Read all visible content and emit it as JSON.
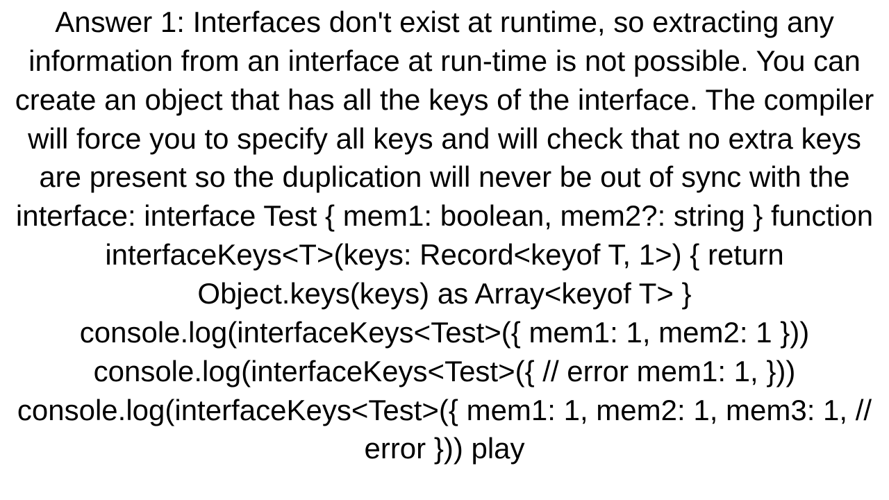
{
  "answer": {
    "text": "Answer 1: Interfaces don't exist at runtime, so extracting any information from an interface at run-time is not possible. You can create an object that has all the keys of the interface. The compiler will force you to specify all keys and will check that no extra keys are present so the duplication will never be out of sync with the interface: interface Test {     mem1: boolean,     mem2?: string }  function interfaceKeys<T>(keys: Record<keyof T, 1>) {     return Object.keys(keys) as Array<keyof T> } console.log(interfaceKeys<Test>({     mem1: 1,     mem2: 1 }))  console.log(interfaceKeys<Test>({ // error     mem1: 1,  }))  console.log(interfaceKeys<Test>({     mem1: 1,     mem2: 1,     mem3: 1,     // error  }))  play"
  }
}
